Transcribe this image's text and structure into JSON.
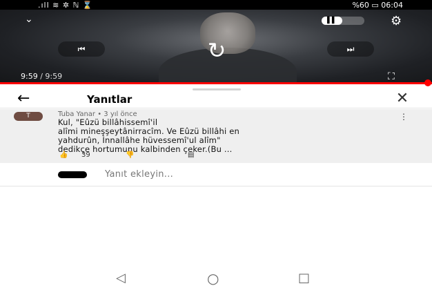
{
  "status_bar": {
    "left_text": ".ıll ≋ ✲ ℕ ⌛",
    "battery": "%60",
    "time": "06:04"
  },
  "player": {
    "current_time": "9:59",
    "separator": " / ",
    "duration": "9:59",
    "progress": 1.0,
    "pip_label": "▌▌",
    "chevron": "⌄",
    "settings_icon": "⚙",
    "prev_icon": "⏮",
    "replay_icon": "↻",
    "next_icon": "⏭",
    "fullscreen_icon": "⛶"
  },
  "replies_sheet": {
    "title": "Yanıtlar",
    "back_icon": "←",
    "close_icon": "✕",
    "comment": {
      "avatar_letter": "T",
      "author": "Tuba Yanar",
      "age": "3 yıl önce",
      "meta_sep": " • ",
      "text_lines": [
        "Kul, \"Eûzü billâhissemî'il",
        "alîmi mineşşeytânirracîm. Ve Eûzü billâhi en",
        "yahdurûn, İnnallâhe hüvessemî'ul alîm\"",
        "dedikçe hortumunu kalbinden çeker.(Bu ..."
      ],
      "likes": "39",
      "like_icon": "👍",
      "dislike_icon": "👎",
      "reply_icon": "▤",
      "menu_icon": "⋮"
    },
    "add_reply_placeholder": "Yanıt ekleyin..."
  },
  "nav_bar": {
    "back": "◁",
    "home": "○",
    "recent": "□"
  },
  "colors": {
    "progress": "#ff0000",
    "avatar": "#6f4c42"
  }
}
